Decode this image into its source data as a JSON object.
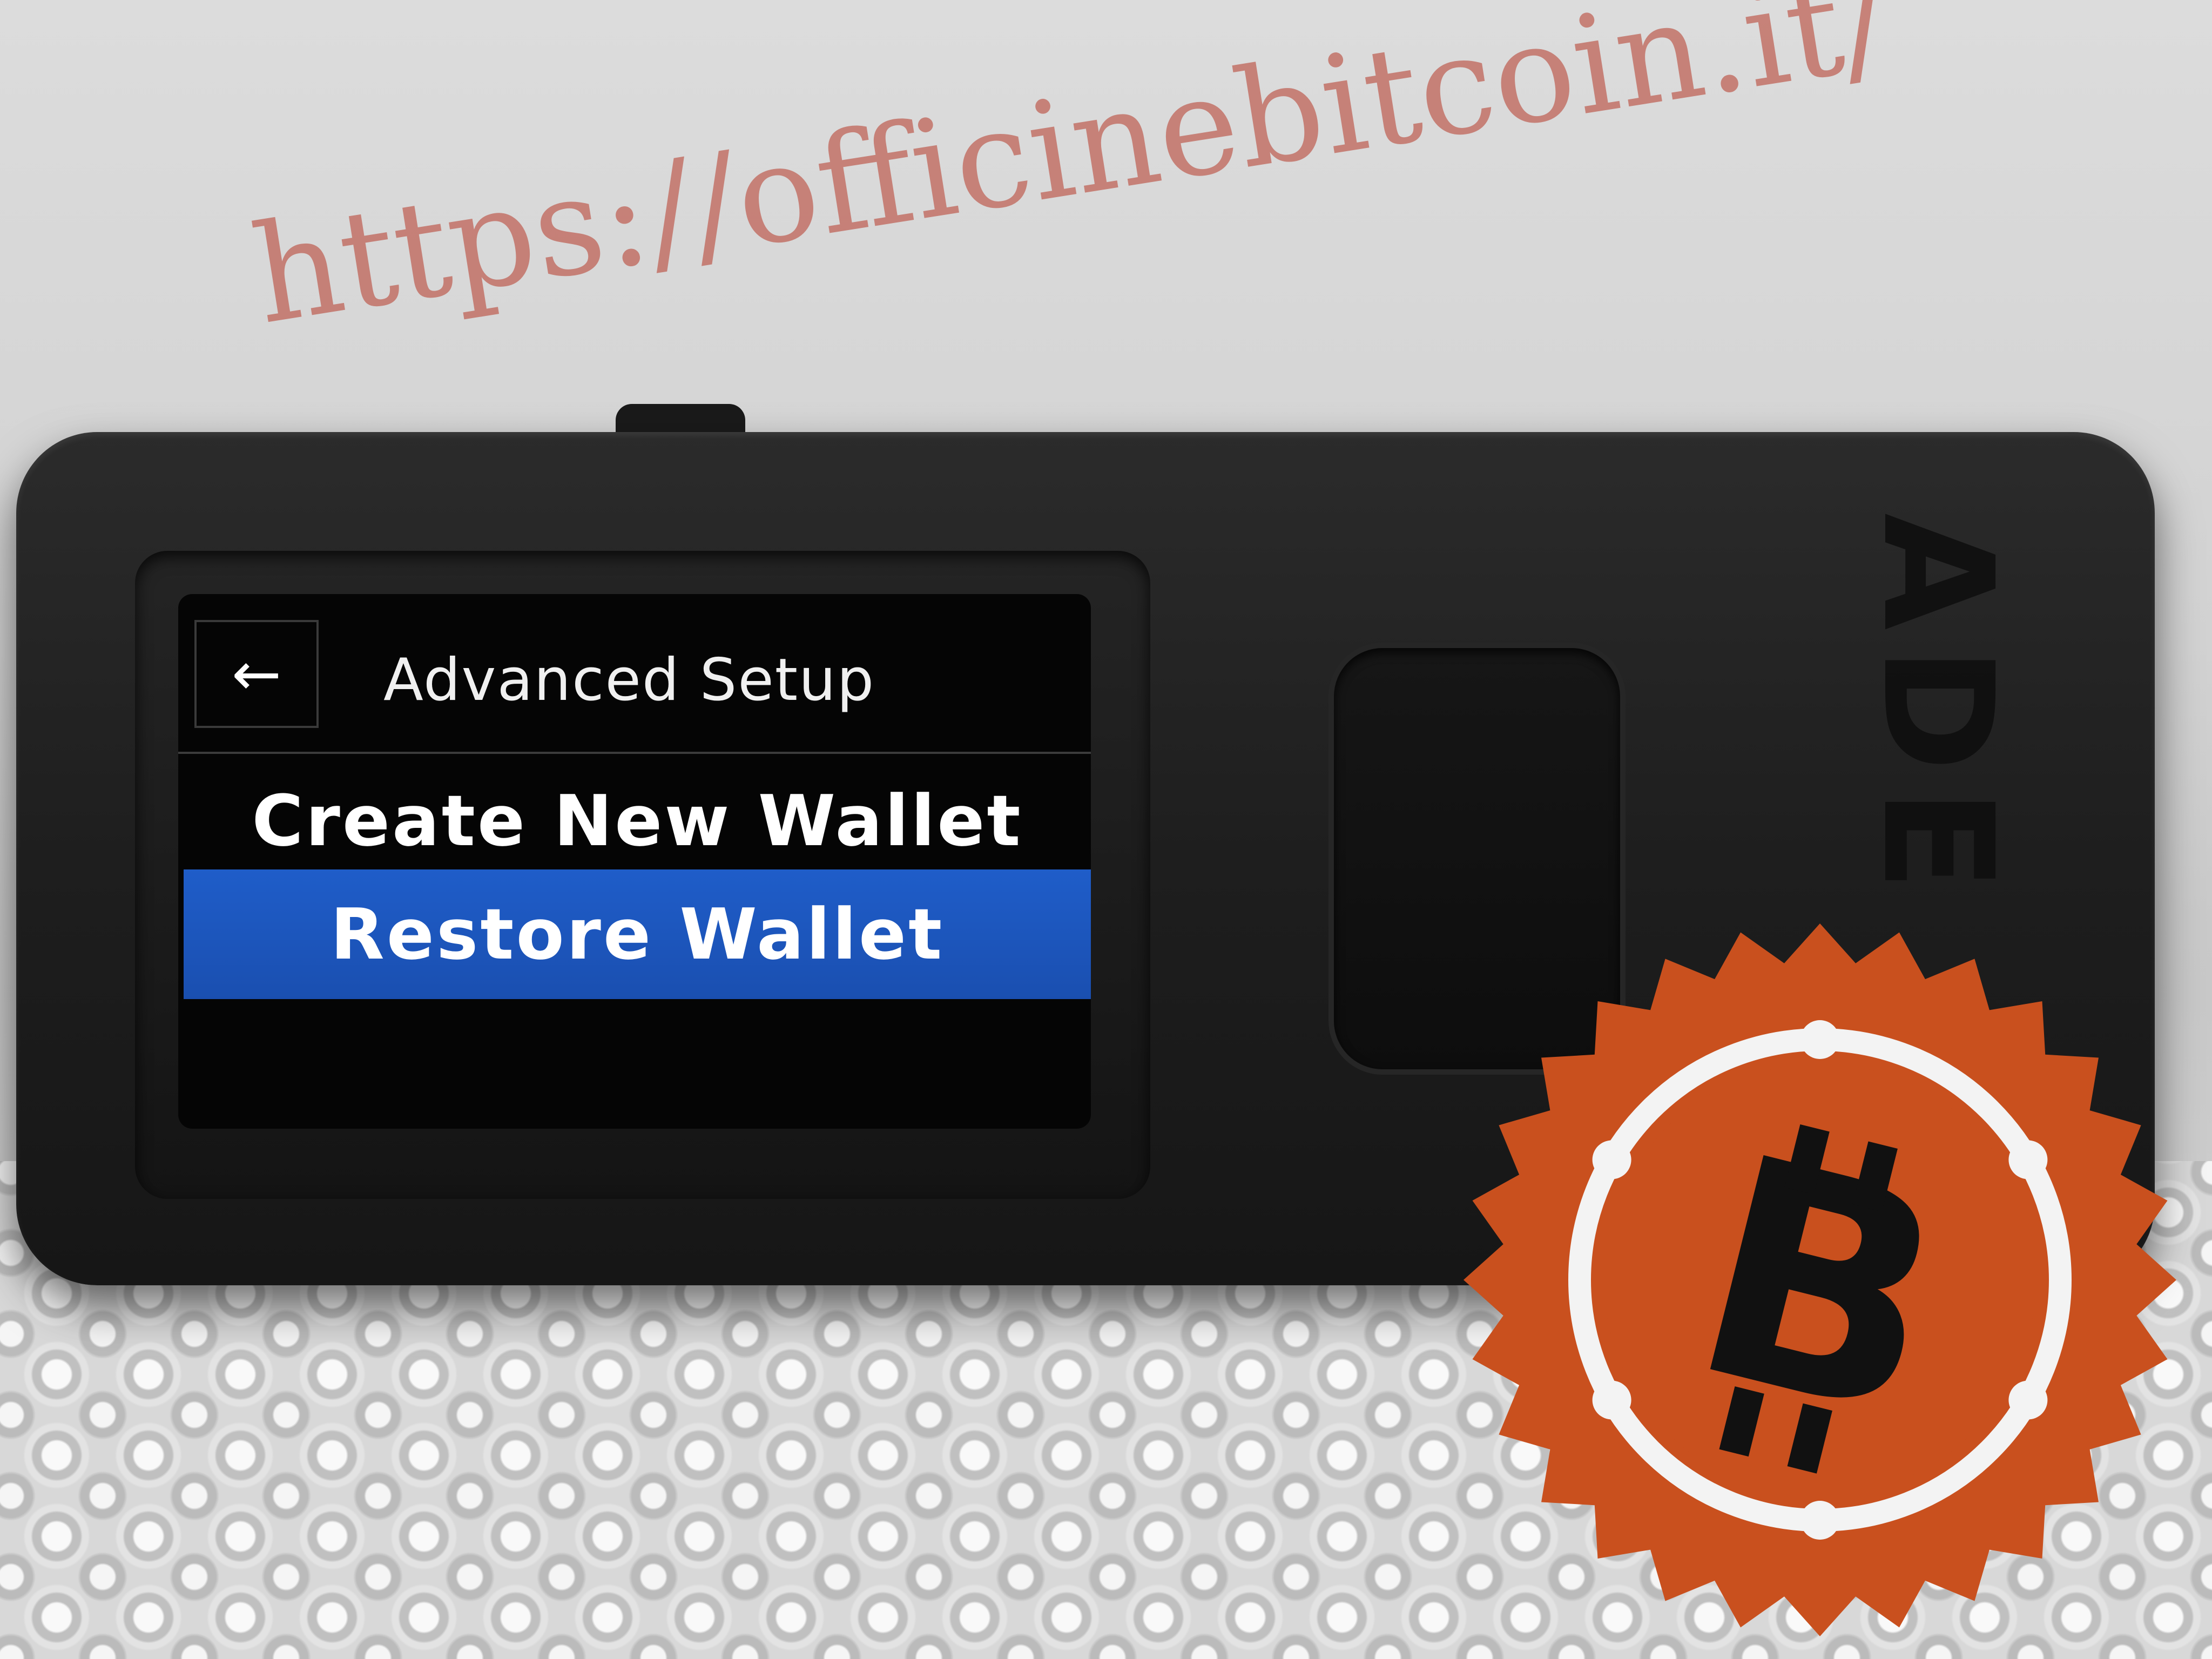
{
  "screen": {
    "back_icon": "←",
    "title": "Advanced Setup",
    "menu": [
      {
        "label": "Create New Wallet",
        "selected": false
      },
      {
        "label": "Restore Wallet",
        "selected": true
      }
    ],
    "selected_color": "#1f5dc9"
  },
  "device": {
    "brand_fragment": "ADE"
  },
  "watermark": {
    "url": "https://officinebitcoin.it/",
    "color": "#b84a3c"
  },
  "seal": {
    "symbol": "bitcoin-logo",
    "color": "#c9501e"
  }
}
